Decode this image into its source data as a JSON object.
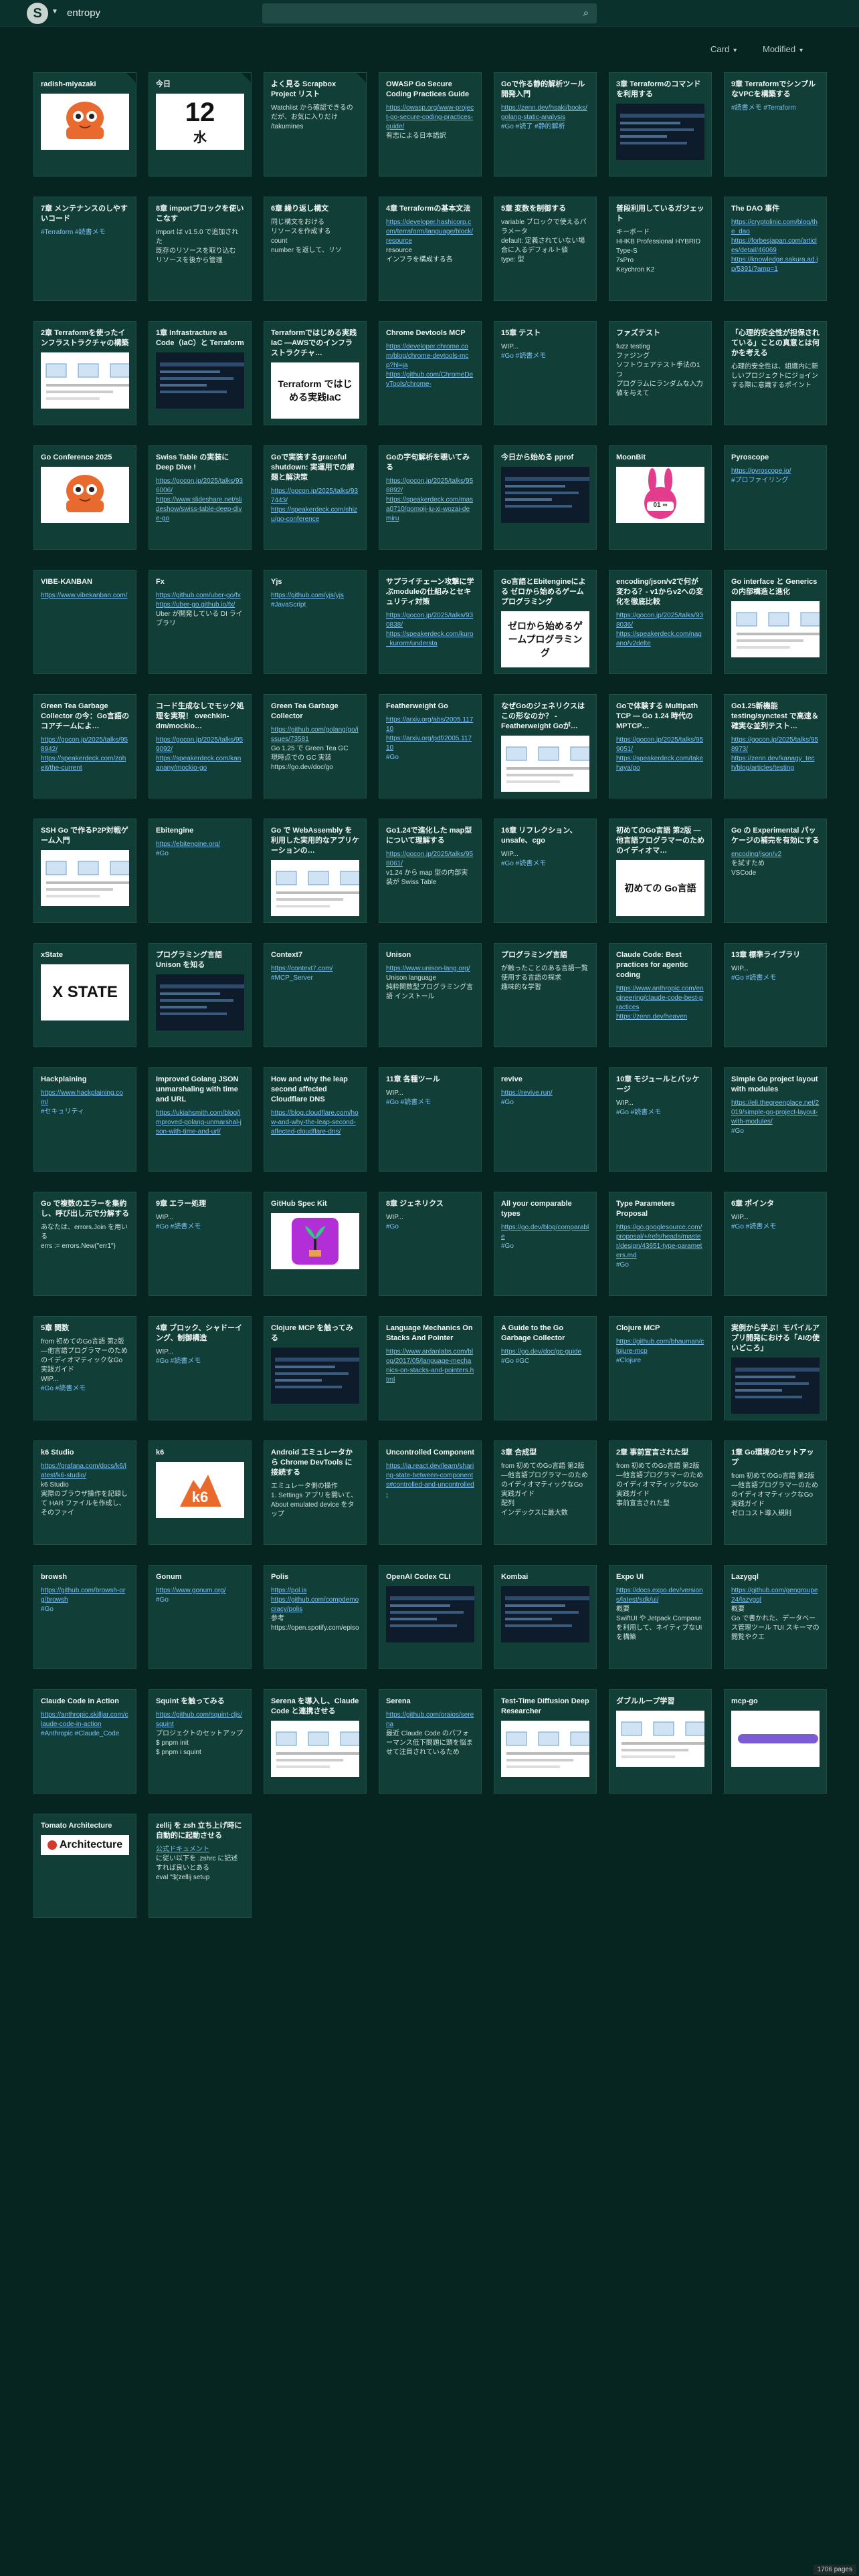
{
  "header": {
    "team_name": "entropy",
    "search_icon": "search-icon"
  },
  "toolbar": {
    "view_label": "Card",
    "sort_label": "Modified"
  },
  "footer": {
    "pages": "1706 pages"
  },
  "cards": [
    {
      "title": "radish-miyazaki",
      "thumb": "octopus",
      "fold": true
    },
    {
      "title": "今日",
      "thumb": "calendar",
      "thumb_number": "12",
      "thumb_day": "水",
      "fold": true
    },
    {
      "title": "よく見る Scrapbox Project リスト",
      "lines": [
        "Watchlist から確認できるのだが、お気に入りだけ",
        "/takumines"
      ],
      "fold": true
    },
    {
      "title": "OWASP Go Secure Coding Practices Guide",
      "links": [
        "https://owasp.org/www-project-go-secure-coding-practices-guide/"
      ],
      "lines": [
        "有志による日本語訳"
      ]
    },
    {
      "title": "Goで作る静的解析ツール開発入門",
      "links": [
        "https://zenn.dev/hsaki/books/golang-static-analysis"
      ],
      "tags": "#Go #読了 #静的解析"
    },
    {
      "title": "3章 Terraformのコマンドを利用する",
      "thumb": "dark-screen"
    },
    {
      "title": "9章 TerraformでシンプルなVPCを構築する",
      "tags": "#読書メモ #Terraform"
    },
    {
      "title": "7章 メンテナンスのしやすいコード",
      "tags": "#Terraform #読書メモ"
    },
    {
      "title": "8章 importブロックを使いこなす",
      "lines": [
        "import は v1.5.0 で追加された",
        "既存のリソースを取り込む",
        "リソースを後から管理"
      ]
    },
    {
      "title": "6章 繰り返し構文",
      "lines": [
        "同じ構文をおける",
        "リソースを作成する",
        "count",
        "number を返して、リソ"
      ]
    },
    {
      "title": "4章 Terraformの基本文法",
      "lines": [
        "resource"
      ],
      "links": [
        "https://developer.hashicorp.com/terraform/language/block/resource"
      ],
      "tail": "インフラを構成する各"
    },
    {
      "title": "5章 変数を制御する",
      "lines": [
        "variable ブロックで使えるパラメータ",
        "default: 定義されていない場合に入るデフォルト値",
        "type: 型"
      ]
    },
    {
      "title": "普段利用しているガジェット",
      "lines": [
        "キーボード",
        "HHKB Professional HYBRID Type-S",
        "7sPro",
        "Keychron K2"
      ]
    },
    {
      "title": "The DAO 事件",
      "links": [
        "https://cryptolinic.com/blog/the_dao",
        "https://forbesjapan.com/articles/detail/46069",
        "https://knowledge.sakura.ad.jp/5391/?amp=1"
      ]
    },
    {
      "title": "2章 Terraformを使ったインフラストラクチャの構築",
      "thumb": "diagram"
    },
    {
      "title": "1章 Infrastracture as Code（IaC）と Terraform",
      "thumb": "diagram-dark"
    },
    {
      "title": "Terraformではじめる実践IaC ―AWSでのインフラストラクチャ…",
      "thumb": "book-terraform",
      "thumb_text": "Terraform ではじめる実践IaC"
    },
    {
      "title": "Chrome Devtools MCP",
      "links": [
        "https://developer.chrome.com/blog/chrome-devtools-mcp?hl=ja",
        "https://github.com/ChromeDevTools/chrome-"
      ]
    },
    {
      "title": "15章 テスト",
      "lines": [
        "WIP..."
      ],
      "tags": "#Go #読書メモ"
    },
    {
      "title": "ファズテスト",
      "lines": [
        "fuzz testing",
        "ファジング",
        "ソフトウェアテスト手法の1つ",
        "プログラムにランダムな入力値を与えて"
      ]
    },
    {
      "title": "「心理的安全性が担保されている」ことの真意とは何かを考える",
      "lines": [
        "心理的安全性は、組織内に新しいプロジェクトにジョインする際に意識するポイント"
      ]
    },
    {
      "title": "Go Conference 2025",
      "thumb": "octopus"
    },
    {
      "title": "Swiss Table の実装に Deep Dive !",
      "links": [
        "https://gocon.jp/2025/talks/936006/",
        "https://www.slideshare.net/slideshow/swiss-table-deep-dive-go"
      ]
    },
    {
      "title": "Goで実装するgraceful shutdown: 実運用での課題と解決策",
      "links": [
        "https://gocon.jp/2025/talks/937443/",
        "https://speakerdeck.com/shizu/go-conference"
      ]
    },
    {
      "title": "Goの字句解析を覗いてみる",
      "links": [
        "https://gocon.jp/2025/talks/958892/",
        "https://speakerdeck.com/masa0710/gomoji-ju-xi-wozai-demiru"
      ]
    },
    {
      "title": "今日から始める pprof",
      "thumb": "dark-screen"
    },
    {
      "title": "MoonBit",
      "thumb": "moonbit",
      "thumb_text": "01 ∞"
    },
    {
      "title": "Pyroscope",
      "links": [
        "https://pyroscope.io/"
      ],
      "tags": "#プロファイリング"
    },
    {
      "title": "VIBE-KANBAN",
      "links": [
        "https://www.vibekanban.com/"
      ]
    },
    {
      "title": "Fx",
      "links": [
        "https://github.com/uber-go/fx",
        "https://uber-go.github.io/fx/"
      ],
      "lines": [
        "Uber が開発している DI ライブラリ"
      ]
    },
    {
      "title": "Yjs",
      "links": [
        "https://github.com/yjs/yjs"
      ],
      "tags": "#JavaScript"
    },
    {
      "title": "サプライチェーン攻撃に学ぶmoduleの仕組みとセキュリティ対策",
      "links": [
        "https://gocon.jp/2025/talks/930838/",
        "https://speakerdeck.com/kuro_kurorrr/understa"
      ]
    },
    {
      "title": "Go言語とEbitengineによる ゼロから始めるゲームプログラミング",
      "thumb": "book-ebiten",
      "thumb_text": "ゼロから始めるゲームプログラミング"
    },
    {
      "title": "encoding/json/v2で何が変わる？- v1からv2への変化を徹底比較",
      "links": [
        "https://gocon.jp/2025/talks/938036/",
        "https://speakerdeck.com/nagano/v2delte"
      ]
    },
    {
      "title": "Go interface と Generics の内部構造と進化",
      "thumb": "slide"
    },
    {
      "title": "Green Tea Garbage Collector の今：Go言語のコアチームによ…",
      "links": [
        "https://gocon.jp/2025/talks/958942/",
        "https://speakerdeck.com/zoheit/the-current"
      ]
    },
    {
      "title": "コード生成なしでモック処理を実現！ ovechkin-dm/mockio…",
      "links": [
        "https://gocon.jp/2025/talks/959092/",
        "https://speakerdeck.com/kananany/mockio-go"
      ]
    },
    {
      "title": "Green Tea Garbage Collector",
      "links": [
        "https://github.com/golang/go/issues/73581"
      ],
      "lines": [
        "Go 1.25 で Green Tea GC",
        "現時点での GC 実装"
      ],
      "tail": "https://go.dev/doc/go"
    },
    {
      "title": "Featherweight Go",
      "links": [
        "https://arxiv.org/abs/2005.11710",
        "https://arxiv.org/pdf/2005.11710"
      ],
      "tags": "#Go"
    },
    {
      "title": "なぜGoのジェネリクスはこの形なのか？ - Featherweight Goが…",
      "thumb": "slide"
    },
    {
      "title": "Goで体験する Multipath TCP ― Go 1.24 時代の MPTCP…",
      "links": [
        "https://gocon.jp/2025/talks/959051/",
        "https://speakerdeck.com/takehaya/go"
      ]
    },
    {
      "title": "Go1.25新機能 testing/synctest で高速＆確実な並列テスト…",
      "links": [
        "https://gocon.jp/2025/talks/958973/",
        "https://zenn.dev/kanagy_tech/blog/articles/testing"
      ]
    },
    {
      "title": "SSH Go で作るP2P対戦ゲーム入門",
      "thumb": "slide"
    },
    {
      "title": "Ebitengine",
      "links": [
        "https://ebitengine.org/"
      ],
      "tags": "#Go"
    },
    {
      "title": "Go で WebAssembly を利用した実用的なアプリケーションの…",
      "thumb": "slide"
    },
    {
      "title": "Go1.24で進化した map型について理解する",
      "links": [
        "https://gocon.jp/2025/talks/958061/"
      ],
      "lines": [
        "v1.24 から map 型の内部実装が Swiss Table"
      ]
    },
    {
      "title": "16章 リフレクション、unsafe、cgo",
      "lines": [
        "WIP..."
      ],
      "tags": "#Go #読書メモ"
    },
    {
      "title": "初めてのGo言語 第2版 ―他言語プログラマーのためのイディオマ…",
      "thumb": "book-go",
      "thumb_text": "初めての Go言語"
    },
    {
      "title": "Go の Experimental パッケージの補完を有効にする",
      "links": [
        "encoding/json/v2"
      ],
      "lines": [
        "を試すため",
        "VSCode"
      ]
    },
    {
      "title": "xState",
      "thumb": "xstate",
      "thumb_text": "X STATE"
    },
    {
      "title": "プログラミング言語 Unison を知る",
      "thumb": "dark-screen"
    },
    {
      "title": "Context7",
      "links": [
        "https://context7.com/"
      ],
      "tags": "#MCP_Server"
    },
    {
      "title": "Unison",
      "lines": [
        "Unison language"
      ],
      "links": [
        "https://www.unison-lang.org/"
      ],
      "tail": "純粋関数型プログラミング言語 インストール"
    },
    {
      "title": "プログラミング言語",
      "lines": [
        "が触ったことのある言語一覧",
        "使用する言語の探求",
        "趣味的な学習"
      ]
    },
    {
      "title": "Claude Code: Best practices for agentic coding",
      "links": [
        "https://www.anthropic.com/engineering/claude-code-best-practices",
        "https://zenn.dev/heaven"
      ]
    },
    {
      "title": "13章 標準ライブラリ",
      "lines": [
        "WIP..."
      ],
      "tags": "#Go #読書メモ"
    },
    {
      "title": "Hackplaining",
      "links": [
        "https://www.hackplaining.com/"
      ],
      "tags": "#セキュリティ"
    },
    {
      "title": "Improved Golang JSON unmarshaling with time and URL",
      "links": [
        "https://ukiahsmith.com/blog/improved-golang-unmarshal-json-with-time-and-url/"
      ]
    },
    {
      "title": "How and why the leap second affected Cloudflare DNS",
      "links": [
        "https://blog.cloudflare.com/how-and-why-the-leap-second-affected-cloudflare-dns/"
      ]
    },
    {
      "title": "11章 各種ツール",
      "lines": [
        "WIP..."
      ],
      "tags": "#Go #読書メモ"
    },
    {
      "title": "revive",
      "links": [
        "https://revive.run/"
      ],
      "tags": "#Go"
    },
    {
      "title": "10章 モジュールとパッケージ",
      "lines": [
        "WIP..."
      ],
      "tags": "#Go #読書メモ"
    },
    {
      "title": "Simple Go project layout with modules",
      "links": [
        "https://eli.thegreenplace.net/2019/simple-go-project-layout-with-modules/"
      ],
      "tags": "#Go"
    },
    {
      "title": "Go で複数のエラーを集約し、呼び出し元で分解する",
      "lines": [
        "あなたは、errors.Join を用いる",
        "errs := errors.New(\"err1\")"
      ]
    },
    {
      "title": "9章 エラー処理",
      "lines": [
        "WIP..."
      ],
      "tags": "#Go #読書メモ"
    },
    {
      "title": "GitHub Spec Kit",
      "thumb": "speckit"
    },
    {
      "title": "8章 ジェネリクス",
      "lines": [
        "WIP..."
      ],
      "tags": "#Go"
    },
    {
      "title": "All your comparable types",
      "links": [
        "https://go.dev/blog/comparable"
      ],
      "tags": "#Go"
    },
    {
      "title": "Type Parameters Proposal",
      "links": [
        "https://go.googlesource.com/proposal/+/refs/heads/master/design/43651-type-parameters.md"
      ],
      "tags": "#Go"
    },
    {
      "title": "6章 ポインタ",
      "lines": [
        "WIP..."
      ],
      "tags": "#Go #読書メモ"
    },
    {
      "title": "5章 関数",
      "lines": [
        "from 初めてのGo言語 第2版 ―他言語プログラマーのためのイディオマティックなGo実践ガイド",
        "WIP..."
      ],
      "tags": "#Go #読書メモ"
    },
    {
      "title": "4章 ブロック、シャドーイング、制御構造",
      "lines": [
        "WIP..."
      ],
      "tags": "#Go #読書メモ"
    },
    {
      "title": "Clojure MCP を触ってみる",
      "thumb": "dark-screen"
    },
    {
      "title": "Language Mechanics On Stacks And Pointer",
      "links": [
        "https://www.ardanlabs.com/blog/2017/05/language-mechanics-on-stacks-and-pointers.html"
      ]
    },
    {
      "title": "A Guide to the Go Garbage Collector",
      "links": [
        "https://go.dev/doc/gc-guide"
      ],
      "tags": "#Go #GC"
    },
    {
      "title": "Clojure MCP",
      "links": [
        "https://github.com/bhauman/clojure-mcp"
      ],
      "tags": "#Clojure"
    },
    {
      "title": "実例から学ぶ！モバイルアプリ開発における「AIの使いどころ」",
      "thumb": "dark-screen"
    },
    {
      "title": "k6 Studio",
      "links": [
        "https://grafana.com/docs/k6/latest/k6-studio/"
      ],
      "lines": [
        "k6 Studio",
        "実際のブラウザ操作を記録して HAR ファイルを作成し、そのファイ"
      ]
    },
    {
      "title": "k6",
      "thumb": "k6",
      "thumb_text": "k6"
    },
    {
      "title": "Android エミュレータから Chrome DevTools に接続する",
      "lines": [
        "エミュレータ側の操作",
        "1. Settings アプリを開いて、About emulated device をタップ"
      ]
    },
    {
      "title": "Uncontrolled Component",
      "links": [
        "https://ja.react.dev/learn/sharing-state-between-components#controlled-and-uncontrolled-"
      ]
    },
    {
      "title": "3章 合成型",
      "lines": [
        "from 初めてのGo言語 第2版 ―他言語プログラマーのためのイディオマティックなGo実践ガイド",
        "配列",
        "インデックスに最大数"
      ]
    },
    {
      "title": "2章 事前宣言された型",
      "lines": [
        "from 初めてのGo言語 第2版 ―他言語プログラマーのためのイディオマティックなGo実践ガイド",
        "事前宣言された型"
      ]
    },
    {
      "title": "1章 Go環境のセットアップ",
      "lines": [
        "from 初めてのGo言語 第2版 ―他言語プログラマーのためのイディオマティックなGo実践ガイド",
        "ゼロコスト導入規則"
      ]
    },
    {
      "title": "browsh",
      "links": [
        "https://github.com/browsh-org/browsh"
      ],
      "tags": "#Go"
    },
    {
      "title": "Gonum",
      "links": [
        "https://www.gonum.org/"
      ],
      "tags": "#Go"
    },
    {
      "title": "Polis",
      "links": [
        "https://pol.is",
        "https://github.com/compdemocracy/polis"
      ],
      "lines": [
        "参考",
        "https://open.spotify.com/episode/5jy2ym58W"
      ]
    },
    {
      "title": "OpenAI Codex CLI",
      "thumb": "dark-screen"
    },
    {
      "title": "Kombai",
      "thumb": "dark-screen"
    },
    {
      "title": "Expo UI",
      "links": [
        "https://docs.expo.dev/versions/latest/sdk/ui/"
      ],
      "lines": [
        "概要",
        "SwiftUI や Jetpack Compose を利用して、ネイティブなUIを構築"
      ]
    },
    {
      "title": "Lazygql",
      "links": [
        "https://github.com/gengroupe24/lazygql"
      ],
      "lines": [
        "概要",
        "Go で書かれた、データベース管理ツール TUI スキーマの閲覧やクエ"
      ]
    },
    {
      "title": "Claude Code in Action",
      "links": [
        "https://anthropic.skilljar.com/claude-code-in-action"
      ],
      "tags": "#Anthropic #Claude_Code"
    },
    {
      "title": "Squint を触ってみる",
      "links": [
        "https://github.com/squint-cljs/squint"
      ],
      "lines": [
        "プロジェクトのセットアップ",
        "$ pnpm init",
        "$ pnpm i squint"
      ]
    },
    {
      "title": "Serena を導入し、Claude Code と連携させる",
      "thumb": "slide"
    },
    {
      "title": "Serena",
      "links": [
        "https://github.com/oraios/serena"
      ],
      "lines": [
        "最近 Claude Code のパフォーマンス低下問題に頭を悩ませて注目されているため"
      ]
    },
    {
      "title": "Test-Time Diffusion Deep Researcher",
      "thumb": "slide"
    },
    {
      "title": "ダブルループ学習",
      "thumb": "diagram"
    },
    {
      "title": "mcp-go",
      "thumb": "mcpgo"
    },
    {
      "title": "Tomato Architecture",
      "thumb": "architecture",
      "thumb_text": "Architecture"
    },
    {
      "title": "zellij を zsh 立ち上げ時に自動的に起動させる",
      "links": [
        "公式ドキュメント"
      ],
      "lines": [
        "に従い以下を .zshrc に記述すれば良いとある",
        "eval \"$(zellij setup"
      ]
    }
  ]
}
